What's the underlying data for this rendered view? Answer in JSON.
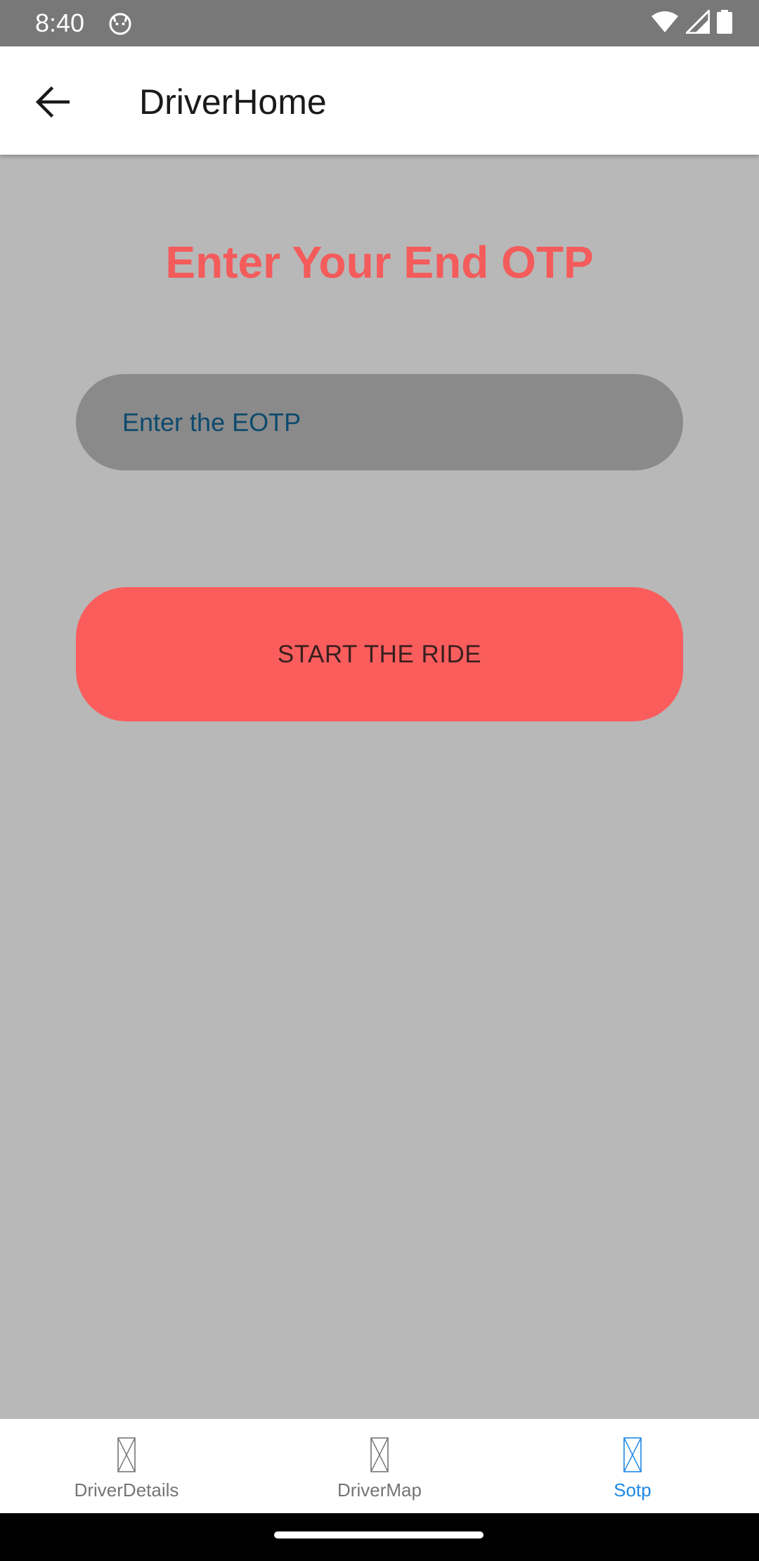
{
  "status_bar": {
    "time": "8:40",
    "icons": [
      "cat-notification-icon",
      "wifi-icon",
      "cell-signal-icon",
      "battery-icon"
    ]
  },
  "app_bar": {
    "title": "DriverHome",
    "back_icon": "arrow-left-icon"
  },
  "main": {
    "heading": "Enter Your End OTP",
    "otp_input": {
      "placeholder": "Enter the EOTP",
      "value": ""
    },
    "start_button_label": "START THE RIDE"
  },
  "bottom_nav": {
    "items": [
      {
        "label": "DriverDetails",
        "icon": "placeholder-icon",
        "active": false
      },
      {
        "label": "DriverMap",
        "icon": "placeholder-icon",
        "active": false
      },
      {
        "label": "Sotp",
        "icon": "placeholder-icon",
        "active": true
      }
    ]
  },
  "colors": {
    "accent": "#f45b5b",
    "button": "#fb5d5d",
    "background": "#b8b8b8",
    "input_bg": "#8a8a8a",
    "nav_active": "#1e88e5"
  }
}
